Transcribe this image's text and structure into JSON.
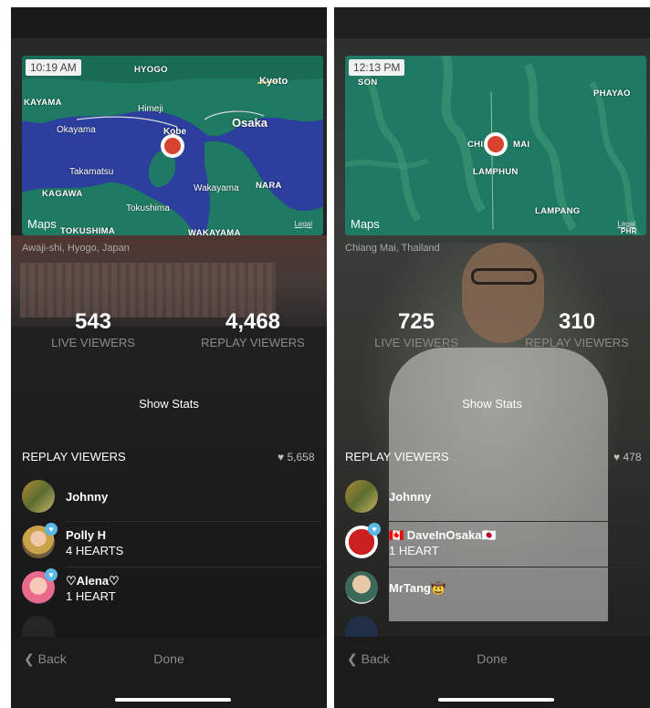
{
  "left": {
    "map": {
      "time": "10:19 AM",
      "labels": [
        "HYOGO",
        "KAYAMA",
        "Kyoto",
        "Himeji",
        "Okayama",
        "Osaka",
        "Kobe",
        "Takamatsu",
        "KAGAWA",
        "Wakayama",
        "NARA",
        "Tokushima",
        "TOKUSHIMA",
        "WAKAYAMA"
      ],
      "brand": "Maps",
      "legal": "Legal"
    },
    "location": "Awaji-shi, Hyogo, Japan",
    "live_count": "543",
    "live_label": "LIVE VIEWERS",
    "replay_count": "4,468",
    "replay_label": "REPLAY VIEWERS",
    "show_stats": "Show Stats",
    "replay_header": "REPLAY VIEWERS",
    "heart_total": "5,658",
    "viewers": [
      {
        "name": "Johnny",
        "sub": ""
      },
      {
        "name": "Polly H",
        "sub": "4 HEARTS"
      },
      {
        "name": "♡Alena♡",
        "sub": "1 HEART"
      }
    ],
    "back": "Back",
    "done": "Done"
  },
  "right": {
    "map": {
      "time": "12:13 PM",
      "labels": [
        "SON",
        "PHAYAO",
        "CHI",
        "MAI",
        "LAMPHUN",
        "LAMPANG",
        "PHR"
      ],
      "brand": "Maps",
      "legal": "Legal"
    },
    "location": "Chiang Mai, Thailand",
    "live_count": "725",
    "live_label": "LIVE VIEWERS",
    "replay_count": "310",
    "replay_label": "REPLAY VIEWERS",
    "show_stats": "Show Stats",
    "replay_header": "REPLAY VIEWERS",
    "heart_total": "478",
    "viewers": [
      {
        "name": "Johnny",
        "sub": ""
      },
      {
        "name": "🇨🇦 DaveInOsaka🇯🇵",
        "sub": "1 HEART"
      },
      {
        "name": "MrTang🤠",
        "sub": ""
      }
    ],
    "back": "Back",
    "done": "Done"
  },
  "colors": {
    "accent_heart": "#5ab8e8",
    "pin": "#d8432f",
    "map_sea": "#2c3e9e",
    "map_land_left": "#1f7a63"
  }
}
